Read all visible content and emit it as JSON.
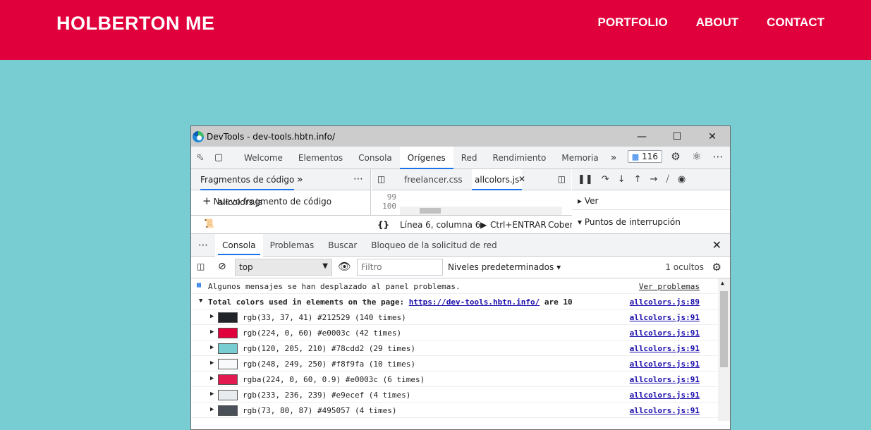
{
  "site": {
    "logo": "HOLBERTON ME",
    "nav": [
      "PORTFOLIO",
      "ABOUT",
      "CONTACT"
    ],
    "colors": {
      "header": "#e0003c",
      "background": "#78cdd2"
    }
  },
  "devtools": {
    "title": "DevTools - dev-tools.hbtn.info/",
    "tabs": [
      "Welcome",
      "Elementos",
      "Consola",
      "Orígenes",
      "Red",
      "Rendimiento",
      "Memoria"
    ],
    "active_tab": "Orígenes",
    "issues_count": "116",
    "sources": {
      "nav_tab": "Fragmentos de código",
      "new_snippet": "Nuevo fragmento de código",
      "snippet_file": "allcolors.js",
      "editor_tabs": [
        "freelancer.css",
        "allcolors.js"
      ],
      "line_numbers": [
        "99",
        "100"
      ],
      "status_position": "Línea 6, columna 6",
      "status_run": "Ctrl+ENTRAR",
      "status_coverage": "Cober",
      "debug_sections": [
        "Ver",
        "Puntos de interrupción"
      ]
    },
    "drawer": {
      "tabs": [
        "Consola",
        "Problemas",
        "Buscar",
        "Bloqueo de la solicitud de red"
      ],
      "active_tab": "Consola",
      "context": "top",
      "filter_placeholder": "Filtro",
      "levels": "Niveles predeterminados",
      "hidden": "1 ocultos"
    },
    "console": {
      "info_message": "Algunos mensajes se han desplazado al panel problemas.",
      "info_link": "Ver problemas",
      "total_prefix": "Total colors used in elements on the page:",
      "total_url": "https://dev-tools.hbtn.info/",
      "total_suffix": "are 10",
      "total_src": "allcolors.js:89",
      "rows": [
        {
          "text": "rgb(33, 37, 41) #212529 (140 times)",
          "color": "#212529",
          "src": "allcolors.js:91"
        },
        {
          "text": "rgb(224, 0, 60) #e0003c (42 times)",
          "color": "#e0003c",
          "src": "allcolors.js:91"
        },
        {
          "text": "rgb(120, 205, 210) #78cdd2 (29 times)",
          "color": "#78cdd2",
          "src": "allcolors.js:91"
        },
        {
          "text": "rgb(248, 249, 250) #f8f9fa (10 times)",
          "color": "#f8f9fa",
          "src": "allcolors.js:91"
        },
        {
          "text": "rgba(224, 0, 60, 0.9) #e0003c (6 times)",
          "color": "#e31a50",
          "src": "allcolors.js:91"
        },
        {
          "text": "rgb(233, 236, 239) #e9ecef (4 times)",
          "color": "#e9ecef",
          "src": "allcolors.js:91"
        },
        {
          "text": "rgb(73, 80, 87) #495057 (4 times)",
          "color": "#495057",
          "src": "allcolors.js:91"
        }
      ]
    }
  }
}
